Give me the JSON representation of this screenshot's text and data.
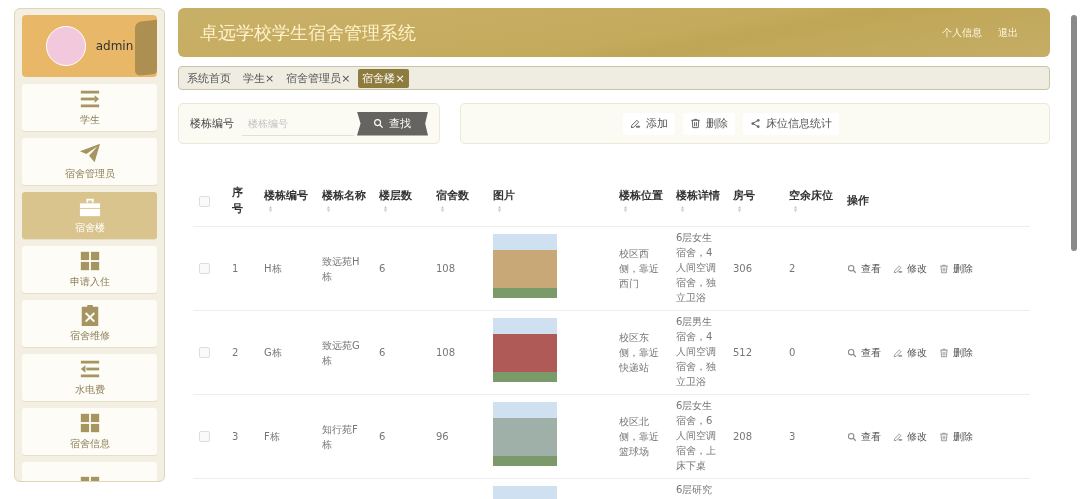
{
  "user": {
    "name": "admin"
  },
  "sidebar": {
    "items": [
      {
        "label": "学生",
        "kind": "list-arrow",
        "selected": false
      },
      {
        "label": "宿舍管理员",
        "kind": "plane",
        "selected": false
      },
      {
        "label": "宿舍楼",
        "kind": "briefcase",
        "selected": true
      },
      {
        "label": "申请入住",
        "kind": "grid",
        "selected": false
      },
      {
        "label": "宿舍维修",
        "kind": "clipboard-x",
        "selected": false
      },
      {
        "label": "水电费",
        "kind": "list-left",
        "selected": false
      },
      {
        "label": "宿舍信息",
        "kind": "grid",
        "selected": false
      },
      {
        "kind": "grid",
        "selected": false
      }
    ]
  },
  "header": {
    "title": "卓远学校学生宿舍管理系统",
    "links": [
      "个人信息",
      "退出"
    ]
  },
  "tabs": [
    {
      "label": "系统首页",
      "selected": false
    },
    {
      "label": "学生",
      "close": "×",
      "selected": false
    },
    {
      "label": "宿舍管理员",
      "close": "×",
      "selected": false
    },
    {
      "label": "宿舍楼",
      "close": "×",
      "selected": true
    }
  ],
  "search": {
    "label": "楼栋编号",
    "placeholder": "楼栋编号",
    "button": "查找"
  },
  "actions": [
    {
      "label": "添加",
      "kind": "pencil"
    },
    {
      "label": "删除",
      "kind": "trash"
    },
    {
      "label": "床位信息统计",
      "kind": "share"
    }
  ],
  "table": {
    "select_all": {
      "checked": false
    },
    "columns": [
      {
        "label": "序号",
        "sortable": false
      },
      {
        "label": "楼栋编号",
        "sortable": true
      },
      {
        "label": "楼栋名称",
        "sortable": true
      },
      {
        "label": "楼层数",
        "sortable": true
      },
      {
        "label": "宿舍数",
        "sortable": true
      },
      {
        "label": "图片",
        "sortable": true
      },
      {
        "label": "楼栋位置",
        "sortable": true
      },
      {
        "label": "楼栋详情",
        "sortable": true
      },
      {
        "label": "房号",
        "sortable": true
      },
      {
        "label": "空余床位",
        "sortable": true
      },
      {
        "label": "操作",
        "sortable": false
      }
    ],
    "rows": [
      {
        "checked": false,
        "index": "1",
        "code": "H栋",
        "name": "致远苑H栋",
        "floors": "6",
        "rooms": "108",
        "location": "校区西侧，靠近西门",
        "detail": "6层女生宿舍，4人间空调宿舍，独立卫浴",
        "room_no": "306",
        "free_beds": "2",
        "ops": [
          "查看",
          "修改",
          "删除"
        ]
      },
      {
        "checked": false,
        "index": "2",
        "code": "G栋",
        "name": "致远苑G栋",
        "floors": "6",
        "rooms": "108",
        "location": "校区东侧，靠近快递站",
        "detail": "6层男生宿舍，4人间空调宿舍，独立卫浴",
        "room_no": "512",
        "free_beds": "0",
        "ops": [
          "查看",
          "修改",
          "删除"
        ]
      },
      {
        "checked": false,
        "index": "3",
        "code": "F栋",
        "name": "知行苑F栋",
        "floors": "6",
        "rooms": "96",
        "location": "校区北侧，靠近篮球场",
        "detail": "6层女生宿舍，6人间空调宿舍，上床下桌",
        "room_no": "208",
        "free_beds": "3",
        "ops": [
          "查看",
          "修改",
          "删除"
        ]
      },
      {
        "detail": "6层研究"
      }
    ]
  }
}
